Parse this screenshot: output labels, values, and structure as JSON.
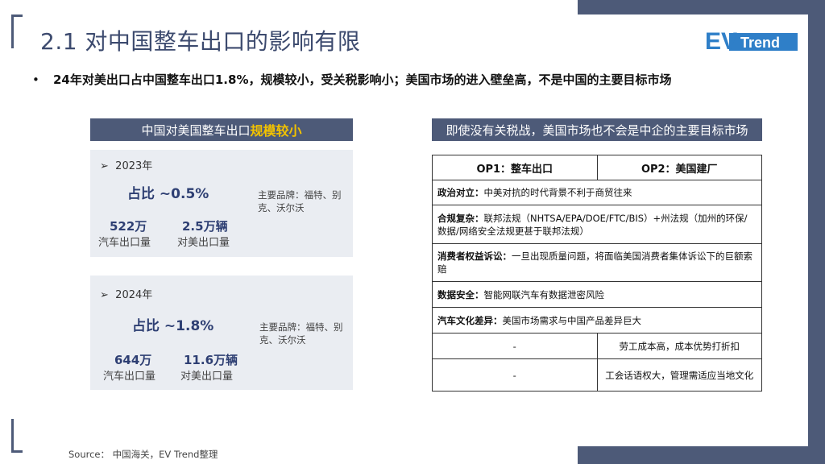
{
  "title": "2.1 对中国整车出口的影响有限",
  "logo": {
    "left": "EV",
    "right": "Trend"
  },
  "bullet": {
    "marker": "•",
    "text": "24年对美出口占中国整车出口1.8%，规模较小，受关税影响小；美国市场的进入壁垒高，不是中国的主要目标市场"
  },
  "left_panel": {
    "header_prefix": "中国对美国整车出口",
    "header_highlight": "规模较小",
    "years": [
      {
        "year": "2023年",
        "share": "占比 ~0.5%",
        "brands": "主要品牌：福特、别克、沃尔沃",
        "total_value": "522万",
        "total_label": "汽车出口量",
        "us_value": "2.5万辆",
        "us_label": "对美出口量"
      },
      {
        "year": "2024年",
        "share": "占比 ~1.8%",
        "brands": "主要品牌：福特、别克、沃尔沃",
        "total_value": "644万",
        "total_label": "汽车出口量",
        "us_value": "11.6万辆",
        "us_label": "对美出口量"
      }
    ]
  },
  "right_panel": {
    "header": "即使没有关税战，美国市场也不会是中企的主要目标市场",
    "columns": [
      "OP1：整车出口",
      "OP2：美国建厂"
    ],
    "full_rows": [
      {
        "tag": "政治对立：",
        "text": "中美对抗的时代背景不利于商贸往来"
      },
      {
        "tag": "合规复杂：",
        "text": "联邦法规（NHTSA/EPA/DOE/FTC/BIS）+州法规（加州的环保/数据/网络安全法规更甚于联邦法规）"
      },
      {
        "tag": "消费者权益诉讼：",
        "text": "一旦出现质量问题，将面临美国消费者集体诉讼下的巨额索赔"
      },
      {
        "tag": "数据安全：",
        "text": "智能网联汽车有数据泄密风险"
      },
      {
        "tag": "汽车文化差异：",
        "text": "美国市场需求与中国产品差异巨大"
      }
    ],
    "split_rows": [
      {
        "op1": "-",
        "op2": "劳工成本高，成本优势打折扣"
      },
      {
        "op1": "-",
        "op2": "工会话语权大，管理需适应当地文化"
      }
    ]
  },
  "source": "Source： 中国海关，EV Trend整理",
  "colors": {
    "navy": "#4d5a78",
    "highlight": "#f2c200",
    "stat": "#2e3f73",
    "box": "#eaedf2"
  }
}
